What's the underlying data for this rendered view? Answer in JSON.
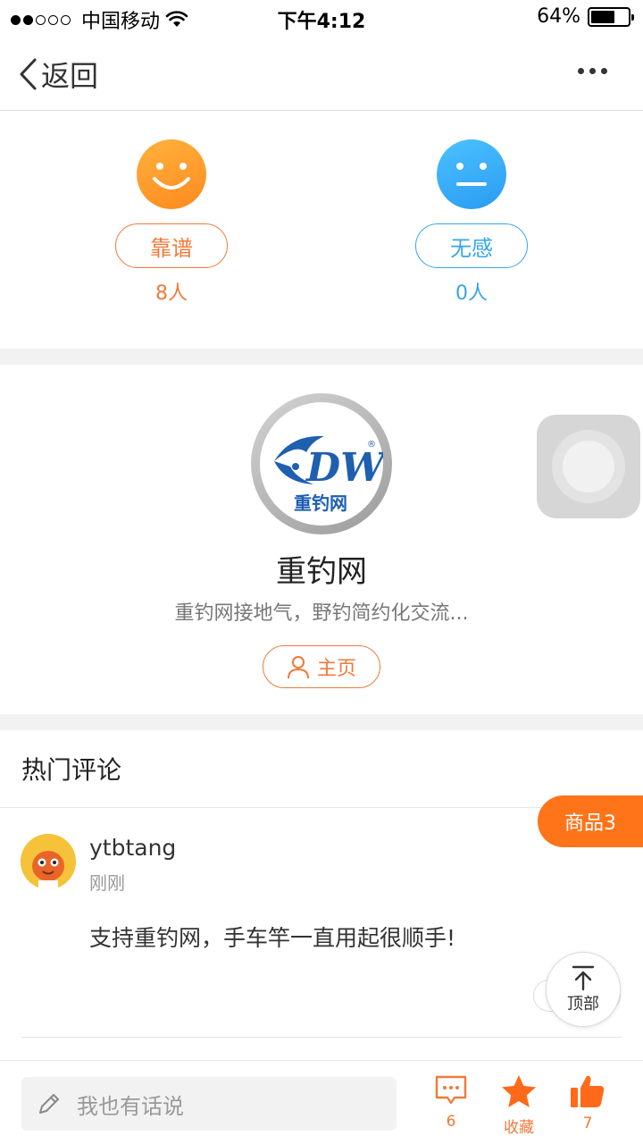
{
  "status_bar": {
    "carrier": "中国移动",
    "time": "下午4:12",
    "battery_text": "64%",
    "battery_level": 0.64
  },
  "nav": {
    "back_label": "返回"
  },
  "vote": {
    "good_label": "靠谱",
    "good_count": "8人",
    "meh_label": "无感",
    "meh_count": "0人"
  },
  "author": {
    "logo_text": "DW",
    "logo_cn": "重钓网",
    "name": "重钓网",
    "desc": "重钓网接地气，野钓简约化交流...",
    "home_label": "主页"
  },
  "comments_section": {
    "title": "热门评论",
    "goods_tag": "商品3",
    "items": [
      {
        "user": "ytbtang",
        "time": "刚刚",
        "text": "支持重钓网，手车竿一直用起很顺手!"
      }
    ]
  },
  "top_button_label": "顶部",
  "bottom_bar": {
    "placeholder": "我也有话说",
    "comment_count": "6",
    "favorite_label": "收藏",
    "like_count": "7"
  },
  "colors": {
    "accent_orange": "#f07a3a",
    "accent_blue": "#36a6e8",
    "goods_tag": "#ff7419"
  }
}
